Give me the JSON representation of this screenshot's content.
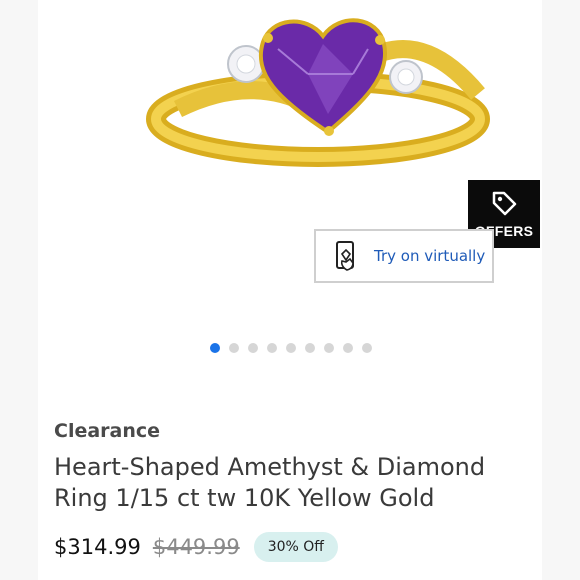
{
  "offers": {
    "label": "OFFERS",
    "icon": "tag-icon"
  },
  "try_on": {
    "label": "Try on virtually",
    "icon": "phone-hand-icon"
  },
  "carousel": {
    "total": 9,
    "active": 1
  },
  "product": {
    "category": "Clearance",
    "title": "Heart-Shaped Amethyst & Diamond Ring 1/15 ct tw 10K Yellow Gold",
    "price": "$314.99",
    "original_price": "$449.99",
    "discount": "30% Off"
  },
  "colors": {
    "gold": "#e8c43a",
    "amethyst": "#6a2aa8",
    "accent_blue": "#1a73e8",
    "badge_bg": "#d8f0ef"
  }
}
